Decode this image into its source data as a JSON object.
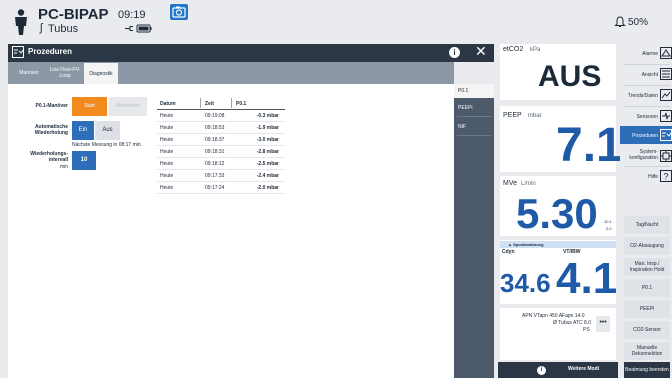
{
  "header": {
    "mode": "PC-BIPAP",
    "tube": "Tubus",
    "time": "09:19",
    "alarm_volume": "50%",
    "icons": [
      "person-icon",
      "camera-icon",
      "plug-battery-icon",
      "bell-icon"
    ]
  },
  "dialog": {
    "title": "Prozeduren",
    "tabs": [
      "Manöver",
      "Low Flow-PV-Loop",
      "Diagnostik"
    ],
    "active_tab": "Diagnostik",
    "side_nav": [
      "P0.1",
      "PEEPi",
      "NIF"
    ],
    "active_side": "P0.1",
    "maneuver_label": "P0.1-Manöver",
    "start_label": "Start",
    "abort_label": "Abbrechen",
    "auto_repeat_label": "Automatische Wiederholung",
    "on_label": "Ein",
    "off_label": "Aus",
    "next_measure": "Nächste Messung in 08:17 min.",
    "interval_label": "Wiederholungs- intervall",
    "interval_unit": "min",
    "interval_value": "10",
    "table": {
      "headers": [
        "Datum",
        "Zeit",
        "P0.1"
      ],
      "rows": [
        [
          "Heute",
          "09:19:08",
          "-0.3 mbar"
        ],
        [
          "Heute",
          "09:18:53",
          "-1.9 mbar"
        ],
        [
          "Heute",
          "09:18:37",
          "-3.0 mbar"
        ],
        [
          "Heute",
          "09:18:31",
          "-2.8 mbar"
        ],
        [
          "Heute",
          "09:18:12",
          "-2.5 mbar"
        ],
        [
          "Heute",
          "09:17:33",
          "-2.4 mbar"
        ],
        [
          "Heute",
          "09:17:24",
          "-2.0 mbar"
        ]
      ]
    }
  },
  "monitor": {
    "etco2_label": "etCO2",
    "etco2_unit": "kPa",
    "etco2_value": "AUS",
    "peep_label": "PEEP",
    "peep_unit": "mbar",
    "peep_value": "7.1",
    "mve_label": "MVe",
    "mve_unit": "L/min",
    "mve_value": "5.30",
    "mve_hi": "10.1",
    "mve_lo": "2.0",
    "spont_label": "Spontanatmung",
    "cdyn_label": "Cdyn",
    "cdyn_value": "34.6",
    "vt_label": "VT/IBW",
    "vt_value": "4.1",
    "info_line1": "APN  VTapn 450  AFapn 14.0",
    "info_line2": "Ø Tubus ATC 8.0",
    "info_line3": "PS",
    "more_label": "•••",
    "bottom_label": "Weitere Modi"
  },
  "menu": {
    "items": [
      {
        "label": "Alarme",
        "icon": "alarm-limits-icon"
      },
      {
        "label": "Ansicht",
        "icon": "view-icon"
      },
      {
        "label": "Trends/Daten",
        "icon": "trends-icon"
      },
      {
        "label": "Sensoren",
        "icon": "sensor-icon"
      },
      {
        "label": "Prozeduren",
        "icon": "procedures-icon"
      },
      {
        "label": "System-konfiguration",
        "icon": "system-config-icon"
      },
      {
        "label": "Hilfe",
        "icon": "help-icon"
      }
    ],
    "active": "Prozeduren",
    "buttons": [
      "Tag/Nacht",
      "O2-Absaugung",
      "Man. Insp./ Inspiration Hold",
      "P0.1",
      "PEEPi",
      "CO2-Sensor",
      "Manuelle Dekonnektion",
      "Beatmung beenden"
    ]
  },
  "colors": {
    "accent_blue": "#2e6eb9",
    "start_orange": "#f38a1f",
    "value_blue": "#1e5aa8",
    "dark_header": "#2c3746"
  }
}
